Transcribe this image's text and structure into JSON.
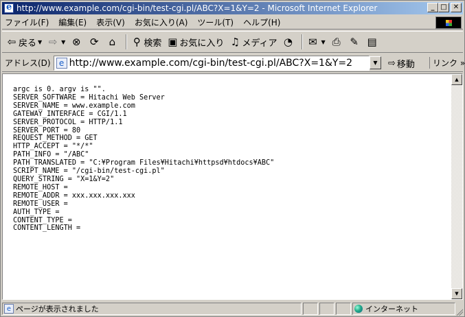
{
  "window": {
    "title": "http://www.example.com/cgi-bin/test-cgi.pl/ABC?X=1&Y=2 - Microsoft Internet Explorer",
    "controls": [
      "_",
      "□",
      "✕"
    ]
  },
  "menu": {
    "items": [
      "ファイル(F)",
      "編集(E)",
      "表示(V)",
      "お気に入り(A)",
      "ツール(T)",
      "ヘルプ(H)"
    ]
  },
  "toolbar": {
    "back_label": "戻る",
    "search_label": "検索",
    "favorites_label": "お気に入り",
    "media_label": "メディア",
    "back_icon": "back-arrow-icon",
    "forward_icon": "forward-arrow-icon",
    "stop_icon": "stop-icon",
    "refresh_icon": "refresh-icon",
    "home_icon": "home-icon",
    "history_icon": "history-icon",
    "mail_icon": "mail-icon",
    "print_icon": "print-icon",
    "edit_icon": "edit-icon",
    "discuss_icon": "discuss-icon"
  },
  "address": {
    "label": "アドレス(D)",
    "url": "http://www.example.com/cgi-bin/test-cgi.pl/ABC?X=1&Y=2",
    "go_label": "移動",
    "links_label": "リンク »"
  },
  "content": {
    "lines": [
      "argc is 0. argv is \"\".",
      "SERVER_SOFTWARE = Hitachi Web Server",
      "SERVER_NAME = www.example.com",
      "GATEWAY_INTERFACE = CGI/1.1",
      "SERVER_PROTOCOL = HTTP/1.1",
      "SERVER_PORT = 80",
      "REQUEST_METHOD = GET",
      "HTTP_ACCEPT = \"*/*\"",
      "PATH_INFO = \"/ABC\"",
      "PATH_TRANSLATED = \"C:¥Program Files¥Hitachi¥httpsd¥htdocs¥ABC\"",
      "SCRIPT_NAME = \"/cgi-bin/test-cgi.pl\"",
      "QUERY_STRING = \"X=1&Y=2\"",
      "REMOTE_HOST =",
      "REMOTE_ADDR = xxx.xxx.xxx.xxx",
      "REMOTE_USER =",
      "AUTH_TYPE =",
      "CONTENT_TYPE =",
      "CONTENT_LENGTH ="
    ]
  },
  "status": {
    "text": "ページが表示されました",
    "zone": "インターネット"
  }
}
